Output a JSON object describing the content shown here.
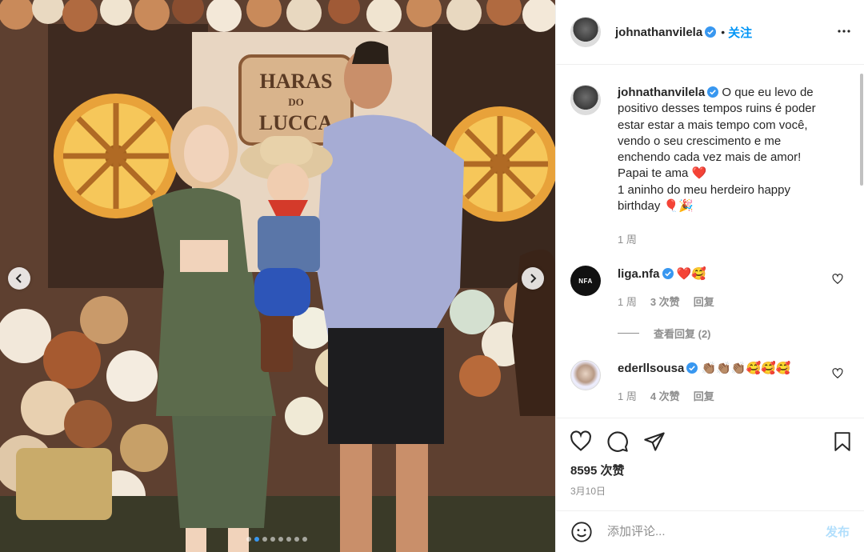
{
  "post": {
    "author": "johnathanvilela",
    "separator": "•",
    "follow_label": "关注",
    "caption": {
      "username": "johnathanvilela",
      "text": "O que eu levo de positivo desses tempos ruins é poder estar estar a mais tempo com você, vendo o seu crescimento e me enchendo cada vez mais de amor! Papai te ama ❤️ 1 aninho do meu herdeiro happy birthday 🎈🎉",
      "lines": [
        "O que eu levo de",
        "positivo desses tempos ruins é poder",
        "estar estar a mais tempo com você,",
        "vendo o seu crescimento e me",
        "enchendo cada vez mais de amor!",
        "Papai te ama ❤️",
        "1 aninho do meu herdeiro happy",
        "birthday 🎈🎉"
      ],
      "time": "1 周"
    },
    "photo_sign": {
      "line1": "HARAS",
      "line2": "DO",
      "line3": "LUCCA"
    },
    "carousel": {
      "count": 8,
      "active_index": 1
    }
  },
  "comments": [
    {
      "username": "liga.nfa",
      "avatar_text": "NFA",
      "text": "❤️🥰",
      "time": "1 周",
      "likes": "3 次赞",
      "reply": "回复",
      "view_replies": "查看回复 (2)"
    },
    {
      "username": "ederllsousa",
      "text": "👏🏽👏🏽👏🏽🥰🥰🥰",
      "time": "1 周",
      "likes": "4 次赞",
      "reply": "回复"
    }
  ],
  "actions": {
    "likes_count": "8595 次赞",
    "date": "3月10日"
  },
  "add_comment": {
    "placeholder": "添加评论...",
    "post_label": "发布"
  },
  "colors": {
    "accent_blue": "#0095f6",
    "verified_blue": "#3897f0",
    "muted": "#8e8e8e",
    "post_disabled": "#b2dffc"
  },
  "icons": [
    "chevron-left-icon",
    "chevron-right-icon",
    "more-icon",
    "verified-icon",
    "heart-icon",
    "comment-icon",
    "share-icon",
    "bookmark-icon",
    "emoji-icon"
  ]
}
